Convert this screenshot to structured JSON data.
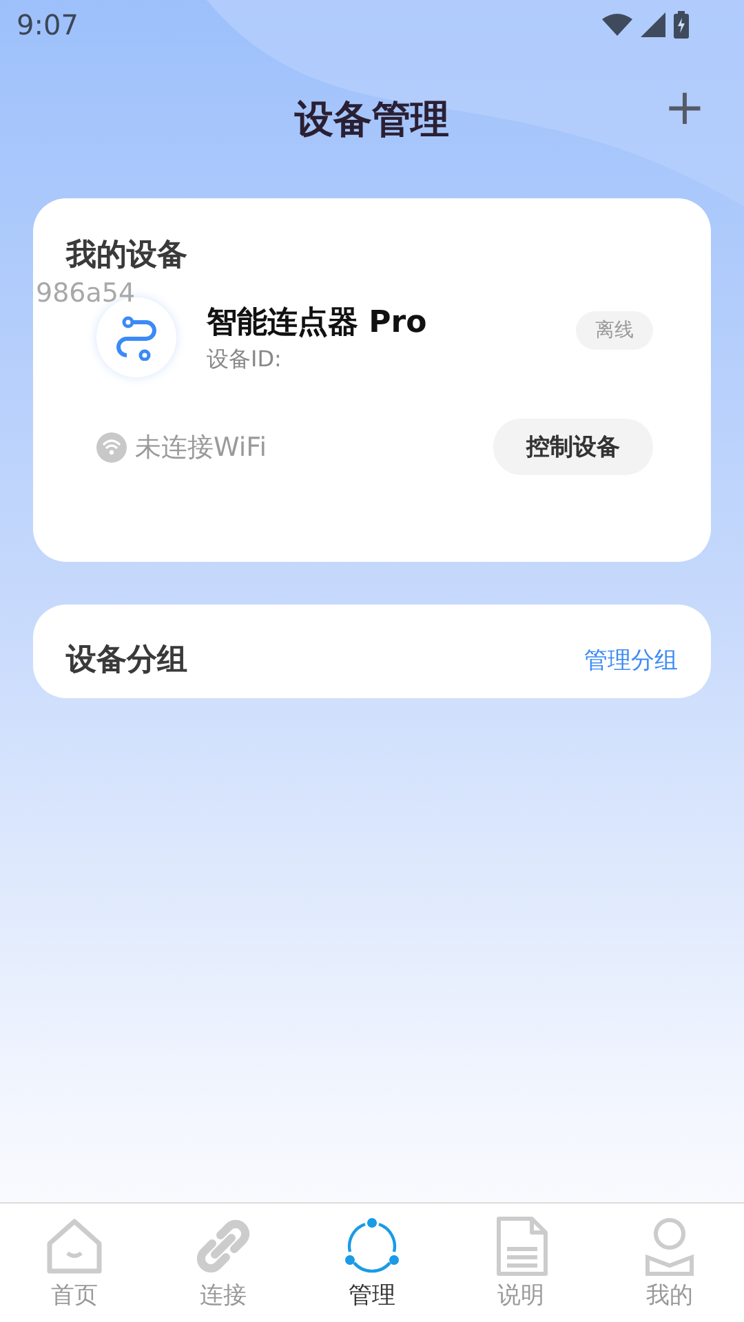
{
  "status_bar": {
    "time": "9:07"
  },
  "header": {
    "title": "设备管理",
    "add_button": "+"
  },
  "my_devices": {
    "title": "我的设备",
    "floating_id": "986a54",
    "device": {
      "name": "智能连点器 Pro",
      "id_label": "设备ID:",
      "status": "离线",
      "wifi_connected": false,
      "wifi_text": "未连接WiFi",
      "control_button": "控制设备"
    }
  },
  "groups": {
    "title": "设备分组",
    "manage_link": "管理分组"
  },
  "tabs": [
    {
      "kind": "home",
      "label": "首页",
      "selected": false
    },
    {
      "kind": "link",
      "label": "连接",
      "selected": false
    },
    {
      "kind": "manage",
      "label": "管理",
      "selected": true
    },
    {
      "kind": "doc",
      "label": "说明",
      "selected": false
    },
    {
      "kind": "user",
      "label": "我的",
      "selected": false
    }
  ]
}
